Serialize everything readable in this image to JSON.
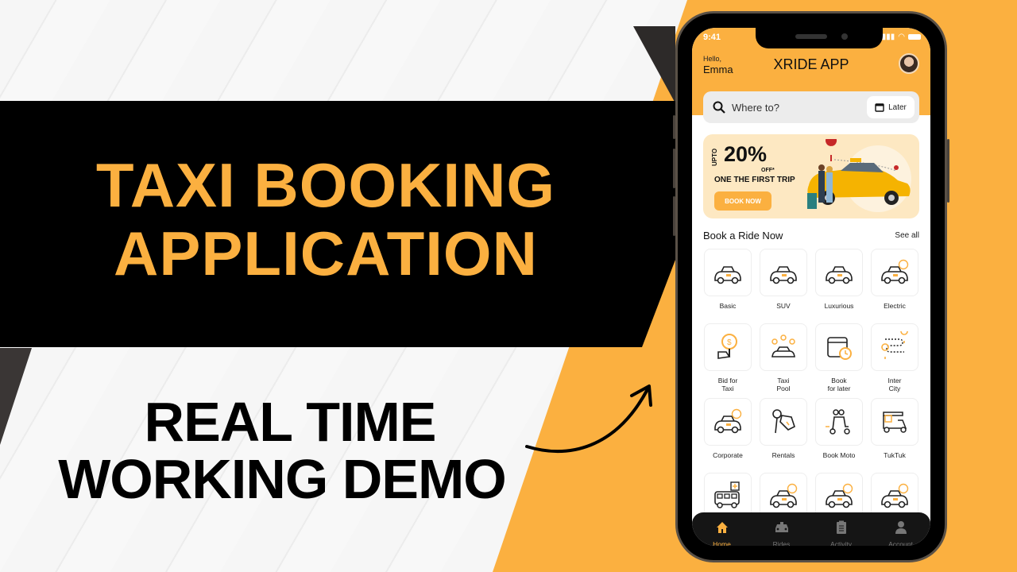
{
  "thumbnail": {
    "headline_line1": "TAXI BOOKING",
    "headline_line2": "APPLICATION",
    "sub_line1": "REAL TIME",
    "sub_line2": "WORKING DEMO",
    "colors": {
      "accent": "#fbb040",
      "dark": "#000000"
    }
  },
  "phone": {
    "status_time": "9:41",
    "greeting": "Hello,",
    "user_name": "Emma",
    "app_title": "XRIDE APP",
    "search": {
      "placeholder": "Where to?",
      "icon": "search-icon"
    },
    "later_button": {
      "label": "Later",
      "icon": "calendar-icon"
    },
    "promo": {
      "upto": "UPTO",
      "percent": "20%",
      "off": "OFF*",
      "subtitle": "ONE THE FIRST TRIP",
      "button": "BOOK NOW"
    },
    "section": {
      "title": "Book a Ride Now",
      "see_all": "See all"
    },
    "services": [
      {
        "label": "Basic",
        "icon": "taxi-icon"
      },
      {
        "label": "SUV",
        "icon": "suv-icon"
      },
      {
        "label": "Luxurious",
        "icon": "sports-car-icon"
      },
      {
        "label": "Electric",
        "icon": "electric-car-icon"
      },
      {
        "label": "Bid for\nTaxi",
        "icon": "bid-icon"
      },
      {
        "label": "Taxi\nPool",
        "icon": "pool-icon"
      },
      {
        "label": "Book\nfor later",
        "icon": "schedule-icon"
      },
      {
        "label": "Inter\nCity",
        "icon": "route-icon"
      },
      {
        "label": "Corporate",
        "icon": "corporate-taxi-icon"
      },
      {
        "label": "Rentals",
        "icon": "key-icon"
      },
      {
        "label": "Book Moto",
        "icon": "scooter-icon"
      },
      {
        "label": "TukTuk",
        "icon": "tuktuk-icon"
      },
      {
        "label": "",
        "icon": "airport-shuttle-icon"
      },
      {
        "label": "",
        "icon": "wheelchair-taxi-icon"
      },
      {
        "label": "",
        "icon": "family-taxi-icon"
      },
      {
        "label": "",
        "icon": "pet-taxi-icon"
      }
    ],
    "nav": [
      {
        "label": "Home",
        "icon": "home-icon",
        "active": true
      },
      {
        "label": "Rides",
        "icon": "car-icon",
        "active": false
      },
      {
        "label": "Activity",
        "icon": "clipboard-icon",
        "active": false
      },
      {
        "label": "Account",
        "icon": "user-icon",
        "active": false
      }
    ]
  }
}
